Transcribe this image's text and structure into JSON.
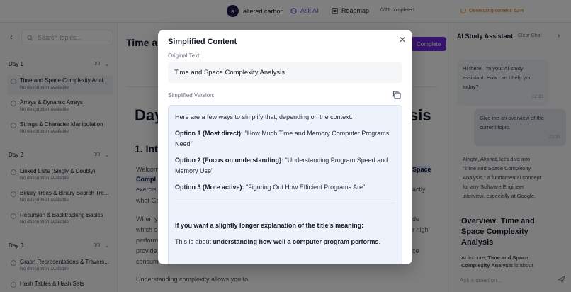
{
  "topbar": {
    "avatar_letter": "a",
    "user_name": "altered carbon",
    "ask_ai": "Ask AI",
    "roadmap": "Roadmap",
    "progress": "0/21 completed",
    "generating": "Generating content: 52%"
  },
  "sidebar": {
    "search_placeholder": "Search topics...",
    "days": [
      {
        "label": "Day 1",
        "count": "0/3",
        "topics": [
          {
            "name": "Time and Space Complexity Anal...",
            "desc": "No description available"
          },
          {
            "name": "Arrays & Dynamic Arrays",
            "desc": "No description available"
          },
          {
            "name": "Strings & Character Manipulation",
            "desc": "No description available"
          }
        ]
      },
      {
        "label": "Day 2",
        "count": "0/3",
        "topics": [
          {
            "name": "Linked Lists (Singly & Doubly)",
            "desc": "No description available"
          },
          {
            "name": "Binary Trees & Binary Search Tre...",
            "desc": "No description available"
          },
          {
            "name": "Recursion & Backtracking Basics",
            "desc": "No description available"
          }
        ]
      },
      {
        "label": "Day 3",
        "count": "0/3",
        "topics": [
          {
            "name": "Graph Representations & Travers...",
            "desc": "No description available"
          },
          {
            "name": "Hash Tables & Hash Sets",
            "desc": ""
          }
        ]
      }
    ]
  },
  "main": {
    "title": "Time and Space Complexity Analysis",
    "complete_label": "Complete",
    "h1_start": "Day",
    "h1_end": "sis",
    "h2": "1. Intr",
    "p1_start": "Welcom",
    "p1_hl_end": "Space",
    "p2_hl": "Compl",
    "p2_end": "actly",
    "p3_start": "exercis",
    "p4_start": "what Go",
    "p5_start": "When y",
    "p5_end": "de",
    "p6_start": "which s",
    "p6_end": "r high-",
    "p7_start": "perform",
    "p8_start": "provide",
    "p8_end": "ce",
    "p9_start": "consum",
    "p10": "Understanding complexity allows you to:"
  },
  "chat": {
    "title": "AI Study Assistant",
    "clear": "Clear Chat",
    "msg1": "Hi there! I'm your AI study assistant. How can I help you today?",
    "msg1_time": "22:33",
    "msg2": "Give me an overview of the current topic.",
    "msg2_time": "22:35",
    "msg3": "Alright, Akshat, let's dive into \"Time and Space Complexity Analysis,\" a fundamental concept for any Software Engineer interview, especially at Google.",
    "heading": "Overview: Time and Space Complexity Analysis",
    "tail_pre": "At its core, ",
    "tail_bold": "Time and Space Complexity Analysis",
    "tail_post": " is about",
    "input_placeholder": "Ask a question..."
  },
  "modal": {
    "title": "Simplified Content",
    "original_label": "Original Text:",
    "original_text": "Time and Space Complexity Analysis",
    "simplified_label": "Simplified Version:",
    "intro": "Here are a few ways to simplify that, depending on the context:",
    "option1_label": "Option 1 (Most direct):",
    "option1_text": " \"How Much Time and Memory Computer Programs Need\"",
    "option2_label": "Option 2 (Focus on understanding):",
    "option2_text": " \"Understanding Program Speed and Memory Use\"",
    "option3_label": "Option 3 (More active):",
    "option3_text": " \"Figuring Out How Efficient Programs Are\"",
    "longer_heading": "If you want a slightly longer explanation of the title's meaning:",
    "about_pre": "This is about ",
    "about_bold": "understanding how well a computer program performs",
    "about_post": "."
  },
  "colors": {
    "accent": "#4f46e5",
    "complete_button": "#6d28d9",
    "generating": "#d97706",
    "simplified_bg": "#eef3fb"
  }
}
